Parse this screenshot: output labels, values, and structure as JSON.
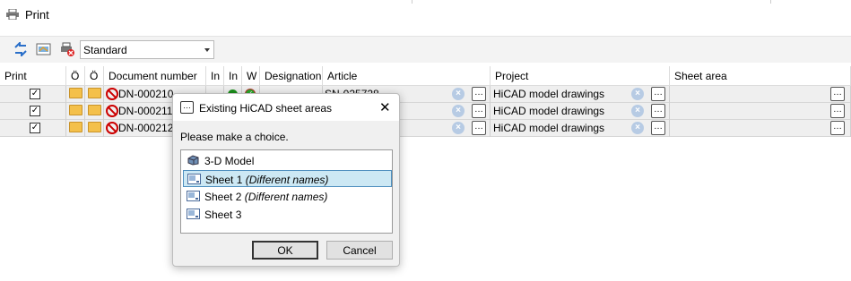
{
  "window": {
    "title": "Print"
  },
  "toolbar": {
    "profile": "Standard"
  },
  "columns": [
    "Print",
    "Ö",
    "Ö",
    "Document number",
    "In",
    "In",
    "W",
    "Designation",
    "Article",
    "Project",
    "Sheet area"
  ],
  "rows": [
    {
      "print": true,
      "document_number": "DN-000210",
      "article": "SN-025728",
      "project": "HiCAD model drawings"
    },
    {
      "print": true,
      "document_number": "DN-000211",
      "article": "",
      "project": "HiCAD model drawings"
    },
    {
      "print": true,
      "document_number": "DN-000212",
      "article": "",
      "project": "HiCAD model drawings"
    }
  ],
  "dialog": {
    "title": "Existing HiCAD sheet areas",
    "prompt": "Please make a choice.",
    "items": [
      {
        "label": "3-D Model",
        "note": ""
      },
      {
        "label": "Sheet 1",
        "note": "(Different names)"
      },
      {
        "label": "Sheet 2",
        "note": "(Different names)"
      },
      {
        "label": "Sheet 3",
        "note": ""
      }
    ],
    "ok": "OK",
    "cancel": "Cancel"
  },
  "icons": {
    "print": "printer-icon",
    "refresh": "refresh-icon",
    "preview": "preview-icon",
    "delete": "delete-print-icon",
    "folder": "folder-icon",
    "no-doc": "no-document-icon",
    "clear": "clear-icon",
    "browse": "browse-ellipsis-icon"
  },
  "colors": {
    "selection": "#cce8f4",
    "status_green": "#1a8f1a"
  }
}
